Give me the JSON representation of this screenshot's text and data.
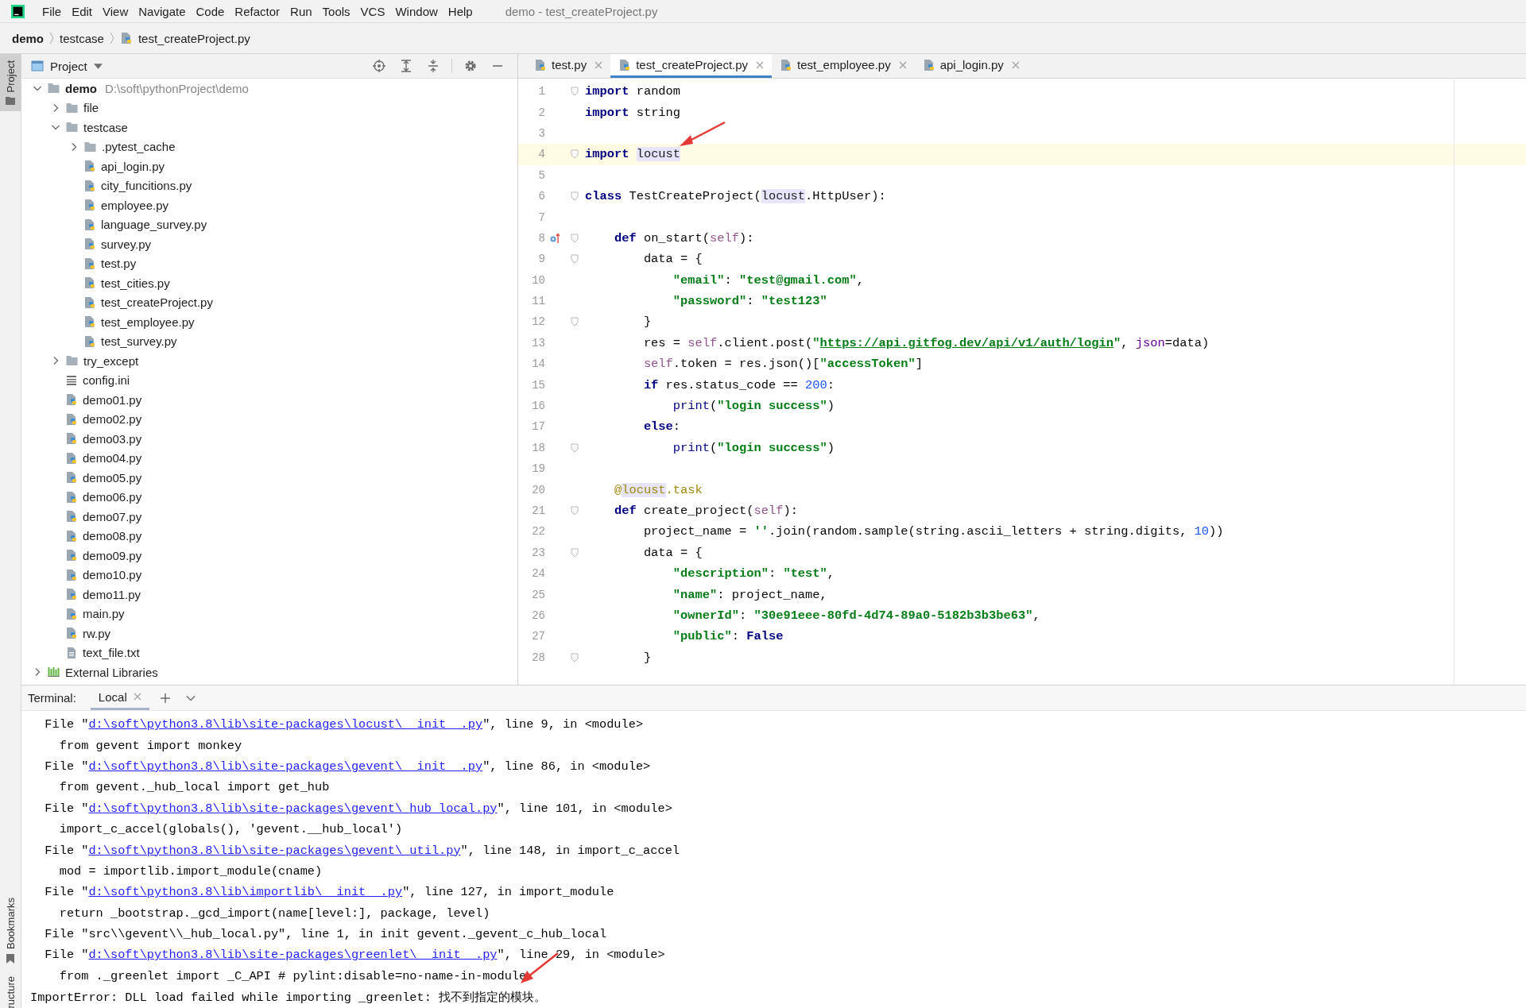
{
  "menu_bar": {
    "items": [
      "File",
      "Edit",
      "View",
      "Navigate",
      "Code",
      "Refactor",
      "Run",
      "Tools",
      "VCS",
      "Window",
      "Help"
    ],
    "title": "demo - test_createProject.py"
  },
  "breadcrumb": [
    {
      "label": "demo",
      "kind": "project"
    },
    {
      "label": "testcase",
      "kind": "folder"
    },
    {
      "label": "test_createProject.py",
      "kind": "python"
    }
  ],
  "tool_strip": {
    "top": [
      {
        "label": "Project",
        "selected": true
      }
    ],
    "bottom": [
      {
        "label": "Bookmarks"
      },
      {
        "label": "ructure"
      }
    ]
  },
  "project_panel": {
    "title": "Project",
    "tree": [
      {
        "label": "demo",
        "kind": "project",
        "path": "D:\\soft\\pythonProject\\demo",
        "expanded": true,
        "children": [
          {
            "label": "file",
            "kind": "folder",
            "expanded": false
          },
          {
            "label": "testcase",
            "kind": "folder",
            "expanded": true,
            "children": [
              {
                "label": ".pytest_cache",
                "kind": "folder",
                "expanded": false
              },
              {
                "label": "api_login.py",
                "kind": "python"
              },
              {
                "label": "city_funcitions.py",
                "kind": "python"
              },
              {
                "label": "employee.py",
                "kind": "python"
              },
              {
                "label": "language_survey.py",
                "kind": "python"
              },
              {
                "label": "survey.py",
                "kind": "python"
              },
              {
                "label": "test.py",
                "kind": "python"
              },
              {
                "label": "test_cities.py",
                "kind": "python"
              },
              {
                "label": "test_createProject.py",
                "kind": "python"
              },
              {
                "label": "test_employee.py",
                "kind": "python"
              },
              {
                "label": "test_survey.py",
                "kind": "python"
              }
            ]
          },
          {
            "label": "try_except",
            "kind": "folder",
            "expanded": false
          },
          {
            "label": "config.ini",
            "kind": "config"
          },
          {
            "label": "demo01.py",
            "kind": "python"
          },
          {
            "label": "demo02.py",
            "kind": "python"
          },
          {
            "label": "demo03.py",
            "kind": "python"
          },
          {
            "label": "demo04.py",
            "kind": "python"
          },
          {
            "label": "demo05.py",
            "kind": "python"
          },
          {
            "label": "demo06.py",
            "kind": "python"
          },
          {
            "label": "demo07.py",
            "kind": "python"
          },
          {
            "label": "demo08.py",
            "kind": "python"
          },
          {
            "label": "demo09.py",
            "kind": "python"
          },
          {
            "label": "demo10.py",
            "kind": "python"
          },
          {
            "label": "demo11.py",
            "kind": "python"
          },
          {
            "label": "main.py",
            "kind": "python"
          },
          {
            "label": "rw.py",
            "kind": "python"
          },
          {
            "label": "text_file.txt",
            "kind": "text"
          }
        ]
      },
      {
        "label": "External Libraries",
        "kind": "library",
        "expanded": false
      }
    ]
  },
  "editor": {
    "tabs": [
      {
        "label": "test.py",
        "selected": false
      },
      {
        "label": "test_createProject.py",
        "selected": true
      },
      {
        "label": "test_employee.py",
        "selected": false
      },
      {
        "label": "api_login.py",
        "selected": false
      }
    ],
    "lines": [
      {
        "number": "1",
        "fold": true,
        "tokens": [
          {
            "text": "import",
            "kind": "keyword"
          },
          {
            "text": " random",
            "kind": "plain"
          }
        ]
      },
      {
        "number": "2",
        "tokens": [
          {
            "text": "import",
            "kind": "keyword"
          },
          {
            "text": " string",
            "kind": "plain"
          }
        ]
      },
      {
        "number": "3"
      },
      {
        "number": "4",
        "fold": true,
        "current": true,
        "tokens": [
          {
            "text": "import ",
            "kind": "keyword"
          },
          {
            "text": "locust",
            "kind": "highlight"
          }
        ]
      },
      {
        "number": "5"
      },
      {
        "number": "6",
        "fold": true,
        "tokens": [
          {
            "text": "class",
            "kind": "keyword"
          },
          {
            "text": " TestCreateProject(",
            "kind": "plain"
          },
          {
            "text": "locust",
            "kind": "highlight"
          },
          {
            "text": ".HttpUser):",
            "kind": "plain"
          }
        ]
      },
      {
        "number": "7"
      },
      {
        "number": "8",
        "fold": true,
        "override": true,
        "tokens": [
          {
            "text": "    def",
            "kind": "keyword"
          },
          {
            "text": " on_start(",
            "kind": "plain"
          },
          {
            "text": "self",
            "kind": "self"
          },
          {
            "text": "):",
            "kind": "plain"
          }
        ]
      },
      {
        "number": "9",
        "fold": true,
        "tokens": [
          {
            "text": "        data = {",
            "kind": "plain"
          }
        ]
      },
      {
        "number": "10",
        "tokens": [
          {
            "text": "            \"email\"",
            "kind": "string"
          },
          {
            "text": ": ",
            "kind": "plain"
          },
          {
            "text": "\"test@gmail.com\"",
            "kind": "string"
          },
          {
            "text": ",",
            "kind": "plain"
          }
        ]
      },
      {
        "number": "11",
        "tokens": [
          {
            "text": "            \"password\"",
            "kind": "string"
          },
          {
            "text": ": ",
            "kind": "plain"
          },
          {
            "text": "\"test123\"",
            "kind": "string"
          }
        ]
      },
      {
        "number": "12",
        "fold": true,
        "tokens": [
          {
            "text": "        }",
            "kind": "plain"
          }
        ]
      },
      {
        "number": "13",
        "tokens": [
          {
            "text": "        res = ",
            "kind": "plain"
          },
          {
            "text": "self",
            "kind": "self"
          },
          {
            "text": ".client.post(",
            "kind": "plain"
          },
          {
            "text": "\"",
            "kind": "string"
          },
          {
            "text": "https://api.gitfog.dev/api/v1/auth/login",
            "kind": "url"
          },
          {
            "text": "\"",
            "kind": "string"
          },
          {
            "text": ", ",
            "kind": "plain"
          },
          {
            "text": "json",
            "kind": "param"
          },
          {
            "text": "=data)",
            "kind": "plain"
          }
        ]
      },
      {
        "number": "14",
        "tokens": [
          {
            "text": "        self",
            "kind": "self"
          },
          {
            "text": ".token = res.json()[",
            "kind": "plain"
          },
          {
            "text": "\"accessToken\"",
            "kind": "string"
          },
          {
            "text": "]",
            "kind": "plain"
          }
        ]
      },
      {
        "number": "15",
        "tokens": [
          {
            "text": "        if",
            "kind": "keyword"
          },
          {
            "text": " res.status_code == ",
            "kind": "plain"
          },
          {
            "text": "200",
            "kind": "number"
          },
          {
            "text": ":",
            "kind": "plain"
          }
        ]
      },
      {
        "number": "16",
        "tokens": [
          {
            "text": "            print",
            "kind": "builtin"
          },
          {
            "text": "(",
            "kind": "plain"
          },
          {
            "text": "\"login success\"",
            "kind": "string"
          },
          {
            "text": ")",
            "kind": "plain"
          }
        ]
      },
      {
        "number": "17",
        "tokens": [
          {
            "text": "        else",
            "kind": "keyword"
          },
          {
            "text": ":",
            "kind": "plain"
          }
        ]
      },
      {
        "number": "18",
        "fold": true,
        "tokens": [
          {
            "text": "            print",
            "kind": "builtin"
          },
          {
            "text": "(",
            "kind": "plain"
          },
          {
            "text": "\"login success\"",
            "kind": "string"
          },
          {
            "text": ")",
            "kind": "plain"
          }
        ]
      },
      {
        "number": "19"
      },
      {
        "number": "20",
        "tokens": [
          {
            "text": "    @",
            "kind": "decorator"
          },
          {
            "text": "locust",
            "kind": "decorator_highlight"
          },
          {
            "text": ".task",
            "kind": "decorator"
          }
        ]
      },
      {
        "number": "21",
        "fold": true,
        "tokens": [
          {
            "text": "    def",
            "kind": "keyword"
          },
          {
            "text": " create_project(",
            "kind": "plain"
          },
          {
            "text": "self",
            "kind": "self"
          },
          {
            "text": "):",
            "kind": "plain"
          }
        ]
      },
      {
        "number": "22",
        "tokens": [
          {
            "text": "        project_name = ",
            "kind": "plain"
          },
          {
            "text": "''",
            "kind": "string"
          },
          {
            "text": ".join(random.sample(string.ascii_letters + string.digits, ",
            "kind": "plain"
          },
          {
            "text": "10",
            "kind": "number"
          },
          {
            "text": "))",
            "kind": "plain"
          }
        ]
      },
      {
        "number": "23",
        "fold": true,
        "tokens": [
          {
            "text": "        data = {",
            "kind": "plain"
          }
        ]
      },
      {
        "number": "24",
        "tokens": [
          {
            "text": "            \"description\"",
            "kind": "string"
          },
          {
            "text": ": ",
            "kind": "plain"
          },
          {
            "text": "\"test\"",
            "kind": "string"
          },
          {
            "text": ",",
            "kind": "plain"
          }
        ]
      },
      {
        "number": "25",
        "tokens": [
          {
            "text": "            \"name\"",
            "kind": "string"
          },
          {
            "text": ": project_name,",
            "kind": "plain"
          }
        ]
      },
      {
        "number": "26",
        "tokens": [
          {
            "text": "            \"ownerId\"",
            "kind": "string"
          },
          {
            "text": ": ",
            "kind": "plain"
          },
          {
            "text": "\"30e91eee-80fd-4d74-89a0-5182b3b3be63\"",
            "kind": "string"
          },
          {
            "text": ",",
            "kind": "plain"
          }
        ]
      },
      {
        "number": "27",
        "tokens": [
          {
            "text": "            \"public\"",
            "kind": "string"
          },
          {
            "text": ": ",
            "kind": "plain"
          },
          {
            "text": "False",
            "kind": "keyword"
          }
        ]
      },
      {
        "number": "28",
        "fold": true,
        "tokens": [
          {
            "text": "        }",
            "kind": "plain"
          }
        ]
      }
    ]
  },
  "terminal": {
    "label": "Terminal:",
    "tabs": [
      {
        "label": "Local",
        "selected": true
      }
    ],
    "lines": [
      [
        {
          "text": "  File \"",
          "kind": "plain"
        },
        {
          "text": "d:\\soft\\python3.8\\lib\\site-packages\\locust\\__init__.py",
          "kind": "link"
        },
        {
          "text": "\", line 9, in <module>",
          "kind": "plain"
        }
      ],
      [
        {
          "text": "    from gevent import monkey",
          "kind": "plain"
        }
      ],
      [
        {
          "text": "  File \"",
          "kind": "plain"
        },
        {
          "text": "d:\\soft\\python3.8\\lib\\site-packages\\gevent\\__init__.py",
          "kind": "link"
        },
        {
          "text": "\", line 86, in <module>",
          "kind": "plain"
        }
      ],
      [
        {
          "text": "    from gevent._hub_local import get_hub",
          "kind": "plain"
        }
      ],
      [
        {
          "text": "  File \"",
          "kind": "plain"
        },
        {
          "text": "d:\\soft\\python3.8\\lib\\site-packages\\gevent\\_hub_local.py",
          "kind": "link"
        },
        {
          "text": "\", line 101, in <module>",
          "kind": "plain"
        }
      ],
      [
        {
          "text": "    import_c_accel(globals(), 'gevent.__hub_local')",
          "kind": "plain"
        }
      ],
      [
        {
          "text": "  File \"",
          "kind": "plain"
        },
        {
          "text": "d:\\soft\\python3.8\\lib\\site-packages\\gevent\\_util.py",
          "kind": "link"
        },
        {
          "text": "\", line 148, in import_c_accel",
          "kind": "plain"
        }
      ],
      [
        {
          "text": "    mod = importlib.import_module(cname)",
          "kind": "plain"
        }
      ],
      [
        {
          "text": "  File \"",
          "kind": "plain"
        },
        {
          "text": "d:\\soft\\python3.8\\lib\\importlib\\__init__.py",
          "kind": "link"
        },
        {
          "text": "\", line 127, in import_module",
          "kind": "plain"
        }
      ],
      [
        {
          "text": "    return _bootstrap._gcd_import(name[level:], package, level)",
          "kind": "plain"
        }
      ],
      [
        {
          "text": "  File \"src\\\\gevent\\\\_hub_local.py\", line 1, in init gevent._gevent_c_hub_local",
          "kind": "plain"
        }
      ],
      [
        {
          "text": "  File \"",
          "kind": "plain"
        },
        {
          "text": "d:\\soft\\python3.8\\lib\\site-packages\\greenlet\\__init__.py",
          "kind": "link"
        },
        {
          "text": "\", line 29, in <module>",
          "kind": "plain"
        }
      ],
      [
        {
          "text": "    from ._greenlet import _C_API # pylint:disable=no-name-in-module",
          "kind": "plain"
        }
      ],
      [
        {
          "text": "ImportError: DLL load failed while importing _greenlet: 找不到指定的模块。",
          "kind": "plain"
        }
      ]
    ]
  }
}
